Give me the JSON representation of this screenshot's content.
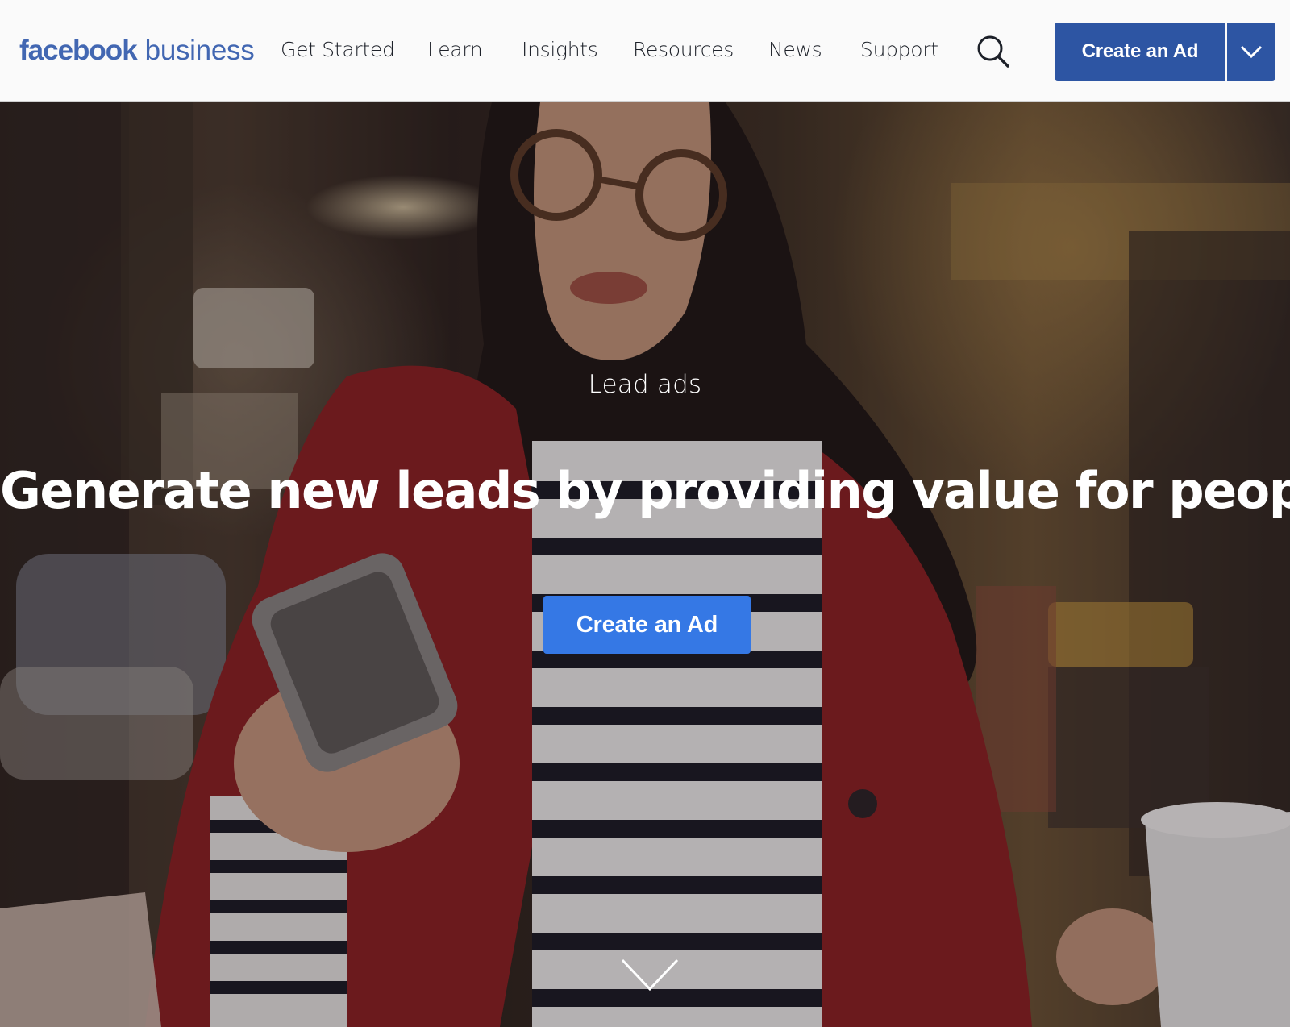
{
  "header": {
    "logo_wordmark": "facebook",
    "logo_sub": "business",
    "nav": [
      {
        "label": "Get Started"
      },
      {
        "label": "Learn"
      },
      {
        "label": "Insights"
      },
      {
        "label": "Resources"
      },
      {
        "label": "News"
      },
      {
        "label": "Support"
      }
    ],
    "search_icon": "search-icon",
    "cta_label": "Create an Ad",
    "cta_caret_icon": "chevron-down-icon"
  },
  "hero": {
    "eyebrow": "Lead ads",
    "headline": "Generate new leads by providing value for people.",
    "button_label": "Create an Ad",
    "scroll_icon": "chevron-down-icon"
  },
  "colors": {
    "brand_blue": "#4267b2",
    "nav_cta_blue": "#2d55a3",
    "hero_button_blue": "#3578e5",
    "nav_text": "#1d2129",
    "nav_bg": "#fafafa"
  }
}
